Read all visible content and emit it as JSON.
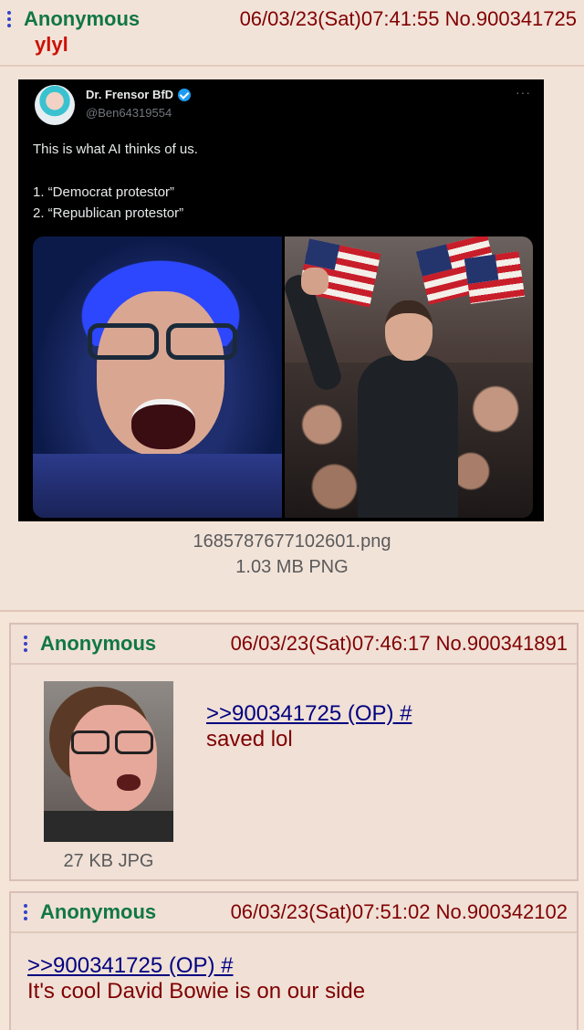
{
  "op": {
    "name": "Anonymous",
    "datetime": "06/03/23(Sat)07:41:55",
    "post_no": "No.900341725",
    "subject": "ylyl",
    "tweet": {
      "display_name": "Dr. Frensor BfD",
      "handle": "@Ben64319554",
      "more": "···",
      "line1": "This is what AI thinks of us.",
      "line2": "1. “Democrat protestor”",
      "line3": "2. “Republican protestor”"
    },
    "file_name": "1685787677102601.png",
    "file_size": "1.03 MB PNG"
  },
  "replies": [
    {
      "name": "Anonymous",
      "datetime": "06/03/23(Sat)07:46:17",
      "post_no": "No.900341891",
      "quote": ">>900341725 (OP) #",
      "text": "saved lol",
      "file_size": "27 KB JPG"
    },
    {
      "name": "Anonymous",
      "datetime": "06/03/23(Sat)07:51:02",
      "post_no": "No.900342102",
      "quote": ">>900341725 (OP) #",
      "text": "It's cool David Bowie is on our side"
    }
  ],
  "colors": {
    "name": "#117743",
    "subject": "#cc1105",
    "text": "#800000",
    "quote_link": "#000080",
    "menu_dots": "#3443c9"
  }
}
